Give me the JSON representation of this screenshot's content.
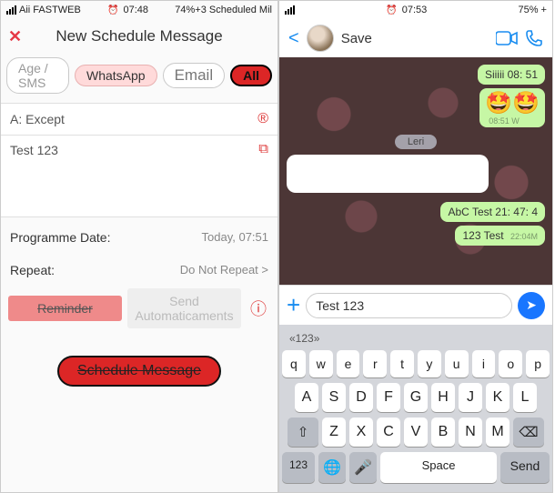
{
  "left": {
    "status": {
      "carrier": "Aii FASTWEB",
      "time": "07:48",
      "battery": "74%+3 Scheduled Mil"
    },
    "title": "New Schedule Message",
    "close_icon": "✕",
    "tabs": {
      "age": "Age / SMS",
      "whatsapp": "WhatsApp",
      "email": "Email",
      "all": "All"
    },
    "to": {
      "label": "A: Except",
      "icon": "®"
    },
    "message": {
      "text": "Test 123",
      "copy_icon": "⧉"
    },
    "programme": {
      "label": "Programme Date:",
      "value": "Today, 07:51"
    },
    "repeat": {
      "label": "Repeat:",
      "value": "Do Not Repeat >"
    },
    "remrow": {
      "reminder": "Reminder",
      "auto": "Send Automaticaments",
      "info": "ⓘ"
    },
    "schedule_label": "Schedule Message"
  },
  "right": {
    "status": {
      "carrier": "",
      "time": "07:53",
      "battery": "75% +"
    },
    "nav": {
      "back": "<",
      "name": "Save",
      "video_icon": "📹",
      "call_icon": "📞"
    },
    "chat": {
      "m1": {
        "text": "Siiiii 08: 51",
        "ts": ""
      },
      "m2": {
        "emoji": "🤩🤩",
        "ts": "08:51 W"
      },
      "day": "Leri",
      "m3": {
        "text": "AbC Test 21: 47: 4"
      },
      "m4": {
        "text": "123 Test",
        "ts": "22:04M"
      }
    },
    "input": {
      "plus": "+",
      "value": "Test 123",
      "send_icon": "➤"
    },
    "kbd": {
      "hint": "«123»",
      "r1": [
        "q",
        "w",
        "e",
        "r",
        "t",
        "y",
        "u",
        "i",
        "o",
        "p"
      ],
      "r2": [
        "A",
        "S",
        "D",
        "F",
        "G",
        "H",
        "J",
        "K",
        "L"
      ],
      "r3": {
        "shift": "⇧",
        "keys": [
          "Z",
          "X",
          "C",
          "V",
          "B",
          "N",
          "M"
        ],
        "bksp": "⌫"
      },
      "r4": {
        "k123": "123",
        "globe": "🌐",
        "mic": "🎤",
        "space": "Space",
        "send": "Send"
      }
    }
  }
}
